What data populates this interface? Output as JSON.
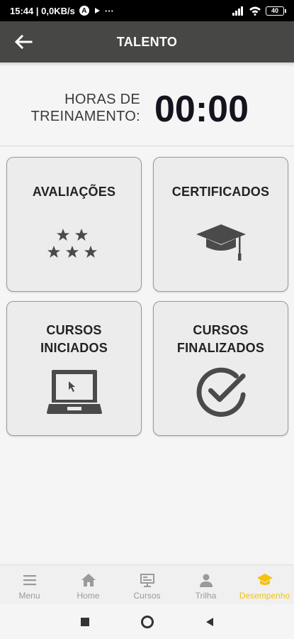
{
  "status_bar": {
    "time_info": "15:44 | 0,0KB/s",
    "badge_letter": "A",
    "more": "···",
    "battery": "40"
  },
  "app_bar": {
    "title": "TALENTO"
  },
  "training": {
    "label_line1": "HORAS DE",
    "label_line2": "TREINAMENTO:",
    "value": "00:00"
  },
  "cards": [
    {
      "line1": "AVALIAÇÕES",
      "line2": "",
      "icon": "stars-icon"
    },
    {
      "line1": "CERTIFICADOS",
      "line2": "",
      "icon": "graduation-cap-icon"
    },
    {
      "line1": "CURSOS",
      "line2": "INICIADOS",
      "icon": "laptop-icon"
    },
    {
      "line1": "CURSOS",
      "line2": "FINALIZADOS",
      "icon": "check-circle-icon"
    }
  ],
  "bottom_nav": [
    {
      "label": "Menu",
      "icon": "hamburger-icon"
    },
    {
      "label": "Home",
      "icon": "home-icon"
    },
    {
      "label": "Cursos",
      "icon": "presentation-icon"
    },
    {
      "label": "Trilha",
      "icon": "person-icon"
    },
    {
      "label": "Desempenho",
      "icon": "graduation-cap-icon",
      "active": true
    }
  ],
  "colors": {
    "app_bar": "#474845",
    "active_nav": "#f4c20d",
    "card_bg": "#ececec"
  }
}
